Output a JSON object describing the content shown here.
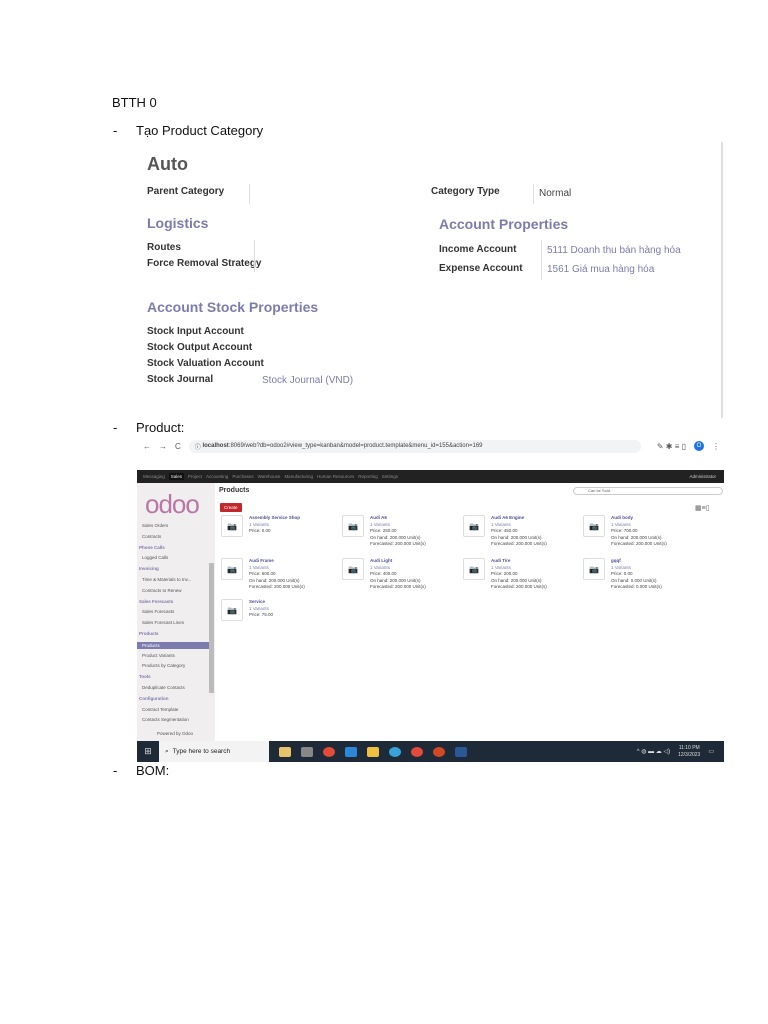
{
  "doc": {
    "title": "BTTH 0",
    "bullet": "-",
    "items": [
      "Tạo Product Category",
      "Product:",
      "BOM:"
    ]
  },
  "category_form": {
    "name": "Auto",
    "parent_category_label": "Parent Category",
    "category_type_label": "Category Type",
    "category_type_value": "Normal",
    "logistics_title": "Logistics",
    "routes_label": "Routes",
    "force_removal_label": "Force Removal Strategy",
    "account_properties_title": "Account Properties",
    "income_account_label": "Income Account",
    "income_account_value": "5111 Doanh thu bán hàng hóa",
    "expense_account_label": "Expense Account",
    "expense_account_value": "1561 Giá mua hàng hóa",
    "stock_title": "Account Stock Properties",
    "stock_input_label": "Stock Input Account",
    "stock_output_label": "Stock Output Account",
    "stock_valuation_label": "Stock Valuation Account",
    "stock_journal_label": "Stock Journal",
    "stock_journal_value": "Stock Journal (VND)"
  },
  "browser": {
    "url_host": "localhost",
    "url_rest": ":8069/web?db=odoo2#view_type=kanban&model=product.template&menu_id=155&action=169",
    "profile": "O"
  },
  "odoo": {
    "menu": [
      "Messaging",
      "Sales",
      "Project",
      "Accounting",
      "Purchases",
      "Warehouse",
      "Manufacturing",
      "Human Resources",
      "Reporting",
      "Settings"
    ],
    "user": "Administrator",
    "logo": "odoo",
    "page_title": "Products",
    "create_label": "Create",
    "search_facet": "Can be Sold",
    "sidebar": [
      {
        "t": "Sales Orders",
        "k": "i"
      },
      {
        "t": "Contracts",
        "k": "i"
      },
      {
        "t": "Phone Calls",
        "k": "c"
      },
      {
        "t": "Logged Calls",
        "k": "i"
      },
      {
        "t": "Invoicing",
        "k": "c"
      },
      {
        "t": "Time & Materials to Inv...",
        "k": "i"
      },
      {
        "t": "Contracts to Renew",
        "k": "i"
      },
      {
        "t": "Sales Forecasts",
        "k": "c"
      },
      {
        "t": "Sales Forecasts",
        "k": "i"
      },
      {
        "t": "Sales Forecast Lines",
        "k": "i"
      },
      {
        "t": "Products",
        "k": "c"
      },
      {
        "t": "Products",
        "k": "s"
      },
      {
        "t": "Product Variants",
        "k": "i"
      },
      {
        "t": "Products by Category",
        "k": "i"
      },
      {
        "t": "Tools",
        "k": "c"
      },
      {
        "t": "Deduplicate Contacts",
        "k": "i"
      },
      {
        "t": "Configuration",
        "k": "c"
      },
      {
        "t": "Contract Template",
        "k": "i"
      },
      {
        "t": "Contacts Segmentation",
        "k": "i"
      }
    ],
    "powered_by": "Powered by Odoo",
    "products": [
      {
        "name": "Assembly Service Shop",
        "variants": "1 Variants",
        "lines": [
          "Price: 0.00"
        ]
      },
      {
        "name": "Audi A6",
        "variants": "1 Variants",
        "lines": [
          "Price: 250.00",
          "On hand: 200.000 Unit(s)",
          "Forecasted: 200.000 Unit(s)"
        ]
      },
      {
        "name": "Audi A6 Engine",
        "variants": "1 Variants",
        "lines": [
          "Price: 450.00",
          "On hand: 200.000 Unit(s)",
          "Forecasted: 200.000 Unit(s)"
        ]
      },
      {
        "name": "Audi body",
        "variants": "1 Variants",
        "lines": [
          "Price: 700.00",
          "On hand: 200.000 Unit(s)",
          "Forecasted: 200.000 Unit(s)"
        ]
      },
      {
        "name": "Audi Frame",
        "variants": "1 Variants",
        "lines": [
          "Price: 600.00",
          "On hand: 200.000 Unit(s)",
          "Forecasted: 200.000 Unit(s)"
        ]
      },
      {
        "name": "Audi Light",
        "variants": "1 Variants",
        "lines": [
          "Price: 400.00",
          "On hand: 200.000 Unit(s)",
          "Forecasted: 200.000 Unit(s)"
        ]
      },
      {
        "name": "Audi Tire",
        "variants": "1 Variants",
        "lines": [
          "Price: 200.00",
          "On hand: 200.000 Unit(s)",
          "Forecasted: 200.000 Unit(s)"
        ]
      },
      {
        "name": "gqqf",
        "variants": "1 Variants",
        "lines": [
          "Price: 0.00",
          "On hand: 0.000 Unit(s)",
          "Forecasted: 0.000 Unit(s)"
        ]
      },
      {
        "name": "Service",
        "variants": "1 Variants",
        "lines": [
          "Price: 75.00"
        ]
      }
    ]
  },
  "taskbar": {
    "search_placeholder": "Type here to search",
    "time": "11:10 PM",
    "date": "12/3/2023"
  }
}
